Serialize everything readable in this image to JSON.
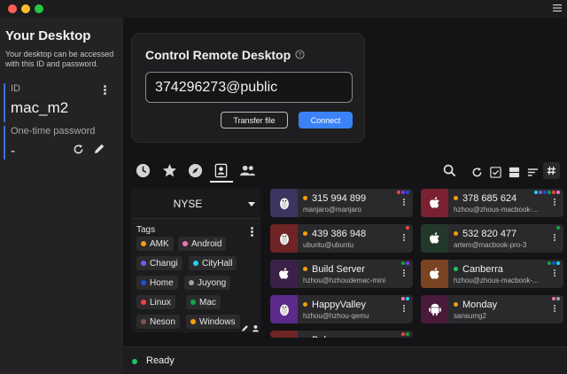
{
  "window": {
    "menu_icon": "hamburger-icon"
  },
  "sidebar": {
    "title": "Your Desktop",
    "description": "Your desktop can be accessed with this ID and password.",
    "id_label": "ID",
    "id_value": "mac_m2",
    "otp_label": "One-time password",
    "otp_value": "-",
    "refresh_icon": "refresh-icon",
    "edit_icon": "pencil-icon"
  },
  "control": {
    "title": "Control Remote Desktop",
    "help_icon": "question-circle-icon",
    "id_input_value": "374296273@public",
    "transfer_label": "Transfer file",
    "connect_label": "Connect",
    "accent_color": "#3b82f6"
  },
  "tabs": [
    {
      "name": "recent",
      "icon": "clock-icon"
    },
    {
      "name": "favorites",
      "icon": "star-icon"
    },
    {
      "name": "discovered",
      "icon": "compass-icon"
    },
    {
      "name": "address-book",
      "icon": "contact-card-icon",
      "selected": true
    },
    {
      "name": "group",
      "icon": "people-icon"
    }
  ],
  "view_tools": [
    "search-icon",
    "refresh-icon",
    "checkbox-icon",
    "grid-view-icon",
    "sort-icon",
    "hashtag-icon"
  ],
  "address_book": {
    "selected": "NYSE",
    "tags_label": "Tags",
    "tags": [
      {
        "name": "AMK",
        "color": "#f59e0b"
      },
      {
        "name": "Android",
        "color": "#f472b6"
      },
      {
        "name": "Changi",
        "color": "#6366f1"
      },
      {
        "name": "CityHall",
        "color": "#22d3ee"
      },
      {
        "name": "Home",
        "color": "#1d4ed8"
      },
      {
        "name": "Juyong",
        "color": "#a3a3a3"
      },
      {
        "name": "Linux",
        "color": "#ef4444"
      },
      {
        "name": "Mac",
        "color": "#16a34a"
      },
      {
        "name": "Neson",
        "color": "#7c5a4a"
      },
      {
        "name": "Windows",
        "color": "#f59e0b"
      }
    ]
  },
  "peers": [
    {
      "id": "315 994 899",
      "sub": "manjaro@manjaro",
      "os": "linux",
      "bg": "#3b3560",
      "status": "#f59e0b",
      "marks": [
        "#ef4444",
        "#7c3aed",
        "#1d4ed8"
      ]
    },
    {
      "id": "378 685 624",
      "sub": "hzhou@zhous-macbook-...",
      "os": "mac",
      "bg": "#7a2232",
      "status": "#f59e0b",
      "marks": [
        "#22d3ee",
        "#6366f1",
        "#1d4ed8",
        "#16a34a",
        "#ef4444",
        "#f472b6"
      ]
    },
    {
      "id": "439 386 948",
      "sub": "ubuntu@ubuntu",
      "os": "linux",
      "bg": "#6e2424",
      "status": "#f59e0b",
      "marks": [
        "#ef4444"
      ]
    },
    {
      "id": "532 820 477",
      "sub": "artem@macbook-pro-3",
      "os": "mac",
      "bg": "#23382a",
      "status": "#f59e0b",
      "marks": [
        "#16a34a"
      ]
    },
    {
      "id": "Build Server",
      "sub": "hzhou@hzhoudemac-mini",
      "os": "mac",
      "bg": "#3a2148",
      "status": "#f59e0b",
      "marks": [
        "#16a34a",
        "#7c3aed"
      ]
    },
    {
      "id": "Canberra",
      "sub": "hzhou@zhous-macbook-...",
      "os": "mac",
      "bg": "#7a4422",
      "status": "#22c55e",
      "marks": [
        "#16a34a",
        "#1d4ed8",
        "#22d3ee"
      ]
    },
    {
      "id": "HappyValley",
      "sub": "hzhou@hzhou-qemu",
      "os": "linux",
      "bg": "#5b2a8a",
      "status": "#f59e0b",
      "marks": [
        "#f472b6",
        "#22d3ee"
      ]
    },
    {
      "id": "Monday",
      "sub": "sansumg2",
      "os": "android",
      "bg": "#4a1a3a",
      "status": "#f59e0b",
      "marks": [
        "#f472b6",
        "#a3a3a3"
      ]
    },
    {
      "id": "Bob",
      "sub": "",
      "os": "linux",
      "bg": "#6e2424",
      "status": "#f59e0b",
      "marks": [
        "#ef4444",
        "#16a34a"
      ]
    }
  ],
  "status": {
    "text": "Ready",
    "color": "#22c55e"
  }
}
